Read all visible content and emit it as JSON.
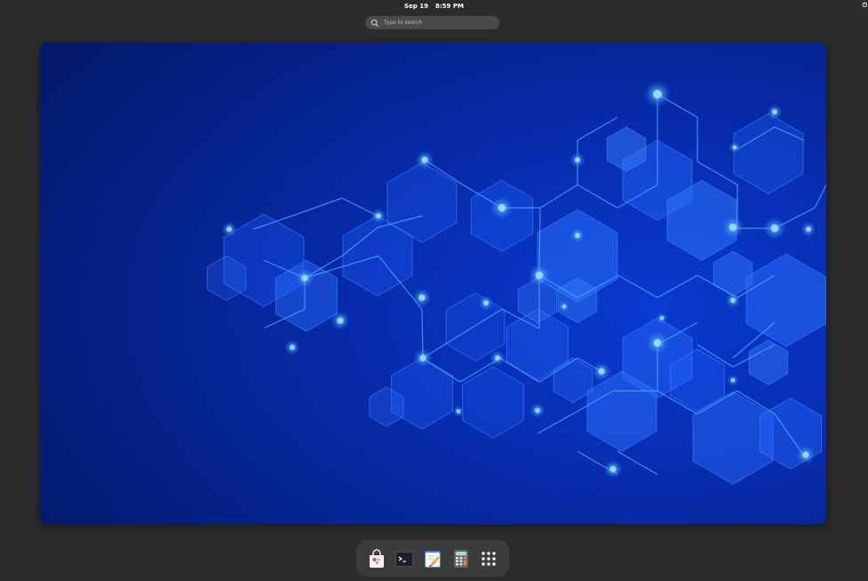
{
  "topbar": {
    "date": "Sep 19",
    "time": "8:59 PM",
    "status": "⏻"
  },
  "search": {
    "placeholder": "Type to search",
    "icon": "search-icon"
  },
  "workspace": {
    "wallpaper": "blue-hexagon-network",
    "colors": {
      "deep": "#031a6e",
      "mid": "#0a3ad0",
      "glow": "#3ea0ff"
    }
  },
  "dash": {
    "apps": [
      {
        "name": "Software",
        "icon": "software-store-icon"
      },
      {
        "name": "Terminal",
        "icon": "terminal-icon"
      },
      {
        "name": "Text Editor",
        "icon": "text-editor-icon"
      },
      {
        "name": "Calculator",
        "icon": "calculator-icon"
      },
      {
        "name": "Show Apps",
        "icon": "app-grid-icon"
      }
    ]
  }
}
